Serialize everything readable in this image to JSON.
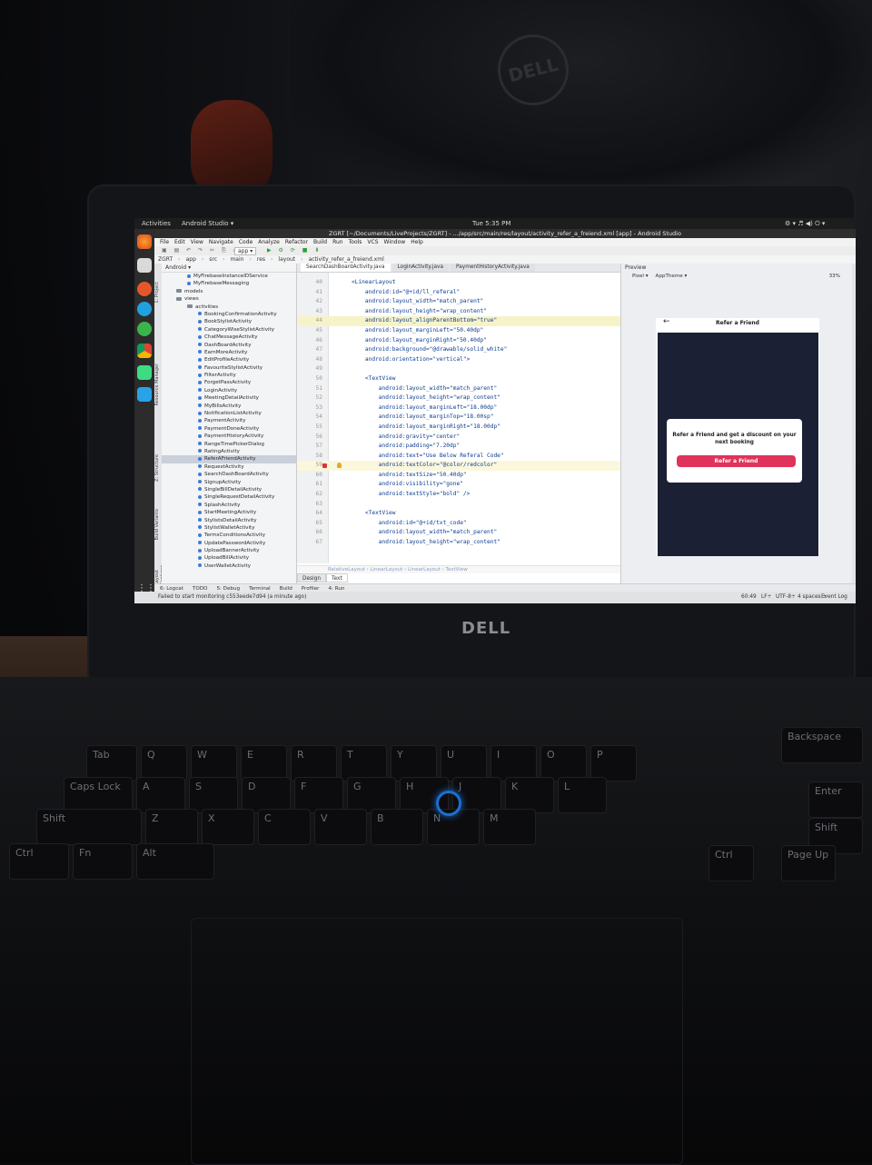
{
  "topbar": {
    "activities": "Activities",
    "app_menu": "Android Studio ▾",
    "clock": "Tue 5:35 PM",
    "indicators": "⚙ ▾  ♬ ◀) ⏻ ▾"
  },
  "window": {
    "title": "ZGRT [~/Documents/LiveProjects/ZGRT] - .../app/src/main/res/layout/activity_refer_a_freiend.xml [app] - Android Studio"
  },
  "menubar": [
    "File",
    "Edit",
    "View",
    "Navigate",
    "Code",
    "Analyze",
    "Refactor",
    "Build",
    "Run",
    "Tools",
    "VCS",
    "Window",
    "Help"
  ],
  "toolbar": {
    "run_config": "app ▾"
  },
  "breadcrumb": [
    "ZGRT",
    "app",
    "src",
    "main",
    "res",
    "layout",
    "activity_refer_a_freiend.xml"
  ],
  "project": {
    "header": "Android ▾",
    "items": [
      {
        "label": "MyFirebaseInstanceIDService",
        "type": "class",
        "indent": 3
      },
      {
        "label": "MyFirebaseMessaging",
        "type": "class",
        "indent": 3
      },
      {
        "label": "models",
        "type": "folder",
        "indent": 2
      },
      {
        "label": "views",
        "type": "folder",
        "indent": 2
      },
      {
        "label": "activities",
        "type": "folder",
        "indent": 3
      },
      {
        "label": "BookingConfirmationActivity",
        "type": "class",
        "indent": 4
      },
      {
        "label": "BookStylistActivity",
        "type": "class",
        "indent": 4
      },
      {
        "label": "CategoryWiseStylistActivity",
        "type": "class",
        "indent": 4
      },
      {
        "label": "ChatMessageActivity",
        "type": "class",
        "indent": 4
      },
      {
        "label": "DashBoardActivity",
        "type": "class",
        "indent": 4
      },
      {
        "label": "EarnMoreActivity",
        "type": "class",
        "indent": 4
      },
      {
        "label": "EditProfileActivity",
        "type": "class",
        "indent": 4
      },
      {
        "label": "FavouriteStylistActivity",
        "type": "class",
        "indent": 4
      },
      {
        "label": "FilterActivity",
        "type": "class",
        "indent": 4
      },
      {
        "label": "ForgetPassActivity",
        "type": "class",
        "indent": 4
      },
      {
        "label": "LoginActivity",
        "type": "class",
        "indent": 4
      },
      {
        "label": "MeetingDetailActivity",
        "type": "class",
        "indent": 4
      },
      {
        "label": "MyBillsActivity",
        "type": "class",
        "indent": 4
      },
      {
        "label": "NotificationListActivity",
        "type": "class",
        "indent": 4
      },
      {
        "label": "PaymentActivity",
        "type": "class",
        "indent": 4
      },
      {
        "label": "PaymentDoneActivity",
        "type": "class",
        "indent": 4
      },
      {
        "label": "PaymentHistoryActivity",
        "type": "class",
        "indent": 4
      },
      {
        "label": "RangeTimePickerDialog",
        "type": "class",
        "indent": 4
      },
      {
        "label": "RatingActivity",
        "type": "class",
        "indent": 4
      },
      {
        "label": "ReferAFriendActivity",
        "type": "class",
        "indent": 4,
        "selected": true
      },
      {
        "label": "RequestActivity",
        "type": "class",
        "indent": 4
      },
      {
        "label": "SearchDashBoardActivity",
        "type": "class",
        "indent": 4
      },
      {
        "label": "SignupActivity",
        "type": "class",
        "indent": 4
      },
      {
        "label": "SingleBillDetailActivity",
        "type": "class",
        "indent": 4
      },
      {
        "label": "SingleRequestDetailActivity",
        "type": "class",
        "indent": 4
      },
      {
        "label": "SplashActivity",
        "type": "class",
        "indent": 4
      },
      {
        "label": "StartMeetingActivity",
        "type": "class",
        "indent": 4
      },
      {
        "label": "StylistsDetailActivity",
        "type": "class",
        "indent": 4
      },
      {
        "label": "StylistWalletActivity",
        "type": "class",
        "indent": 4
      },
      {
        "label": "TermsConditionsActivity",
        "type": "class",
        "indent": 4
      },
      {
        "label": "UpdatePasswordActivity",
        "type": "class",
        "indent": 4
      },
      {
        "label": "UploadBannerActivity",
        "type": "class",
        "indent": 4
      },
      {
        "label": "UploadBillActivity",
        "type": "class",
        "indent": 4
      },
      {
        "label": "UserWalletActivity",
        "type": "class",
        "indent": 4
      }
    ]
  },
  "editor_tabs": [
    {
      "label": "SearchDashBoardActivity.java",
      "active": true
    },
    {
      "label": "LoginActivity.java",
      "active": false
    },
    {
      "label": "PaymentHistoryActivity.java",
      "active": false
    }
  ],
  "code_lines": [
    {
      "n": "40",
      "text": "<LinearLayout"
    },
    {
      "n": "41",
      "text": "    android:id=\"@+id/ll_referal\""
    },
    {
      "n": "42",
      "text": "    android:layout_width=\"match_parent\""
    },
    {
      "n": "43",
      "text": "    android:layout_height=\"wrap_content\""
    },
    {
      "n": "44",
      "text": "    android:layout_alignParentBottom=\"true\"",
      "hl": "yellow"
    },
    {
      "n": "45",
      "text": "    android:layout_marginLeft=\"50.40dp\""
    },
    {
      "n": "46",
      "text": "    android:layout_marginRight=\"50.40dp\""
    },
    {
      "n": "47",
      "text": "    android:background=\"@drawable/solid_white\""
    },
    {
      "n": "48",
      "text": "    android:orientation=\"vertical\">"
    },
    {
      "n": "49",
      "text": ""
    },
    {
      "n": "50",
      "text": "    <TextView"
    },
    {
      "n": "51",
      "text": "        android:layout_width=\"match_parent\""
    },
    {
      "n": "52",
      "text": "        android:layout_height=\"wrap_content\""
    },
    {
      "n": "53",
      "text": "        android:layout_marginLeft=\"18.00dp\""
    },
    {
      "n": "54",
      "text": "        android:layout_marginTop=\"18.00sp\""
    },
    {
      "n": "55",
      "text": "        android:layout_marginRight=\"18.00dp\""
    },
    {
      "n": "56",
      "text": "        android:gravity=\"center\""
    },
    {
      "n": "57",
      "text": "        android:padding=\"7.20dp\""
    },
    {
      "n": "58",
      "text": "        android:text=\"Use Below Referal Code\""
    },
    {
      "n": "59",
      "text": "        android:textColor=\"@color/redcolor\"",
      "hl": "current",
      "marker": true
    },
    {
      "n": "60",
      "text": "        android:textSize=\"50.40dp\""
    },
    {
      "n": "61",
      "text": "        android:visibility=\"gone\""
    },
    {
      "n": "62",
      "text": "        android:textStyle=\"bold\" />"
    },
    {
      "n": "63",
      "text": ""
    },
    {
      "n": "64",
      "text": "    <TextView"
    },
    {
      "n": "65",
      "text": "        android:id=\"@+id/txt_code\""
    },
    {
      "n": "66",
      "text": "        android:layout_width=\"match_parent\""
    },
    {
      "n": "67",
      "text": "        android:layout_height=\"wrap_content\""
    }
  ],
  "editor_breadcrumb": "RelativeLayout  ›  LinearLayout  ›  LinearLayout  ›  TextView",
  "design_tabs": {
    "design": "Design",
    "text": "Text"
  },
  "preview": {
    "header": "Preview",
    "device": "Pixel ▾",
    "theme": "AppTheme ▾",
    "zoom": "33%",
    "screen_title": "Refer a Friend",
    "back_glyph": "←",
    "card_text": "Refer a Friend and get a discount on your next booking",
    "button_label": "Refer a Friend",
    "button_color": "#e0325a",
    "background_color": "#1b2034"
  },
  "bottom_tools": [
    "6: Logcat",
    "TODO",
    "5: Debug",
    "Terminal",
    "Build",
    "Profiler",
    "4: Run"
  ],
  "event_log": "Event Log",
  "status": {
    "message": "Failed to start monitoring c553eede7d94 (a minute ago)",
    "position": "60:49",
    "line_sep": "LF÷",
    "encoding": "UTF-8÷",
    "indent": "4 spaces ÷"
  },
  "hardware": {
    "brand": "DELL",
    "keys": [
      "Tab",
      "Q",
      "W",
      "E",
      "R",
      "T",
      "Y",
      "U",
      "I",
      "O",
      "P",
      "Caps Lock",
      "A",
      "S",
      "D",
      "F",
      "G",
      "H",
      "J",
      "K",
      "L",
      "Shift",
      "Z",
      "X",
      "C",
      "V",
      "B",
      "N",
      "M",
      "Ctrl",
      "Fn",
      "Alt",
      "Enter",
      "Shift",
      "Ctrl",
      "Page Up",
      "Backspace"
    ]
  }
}
